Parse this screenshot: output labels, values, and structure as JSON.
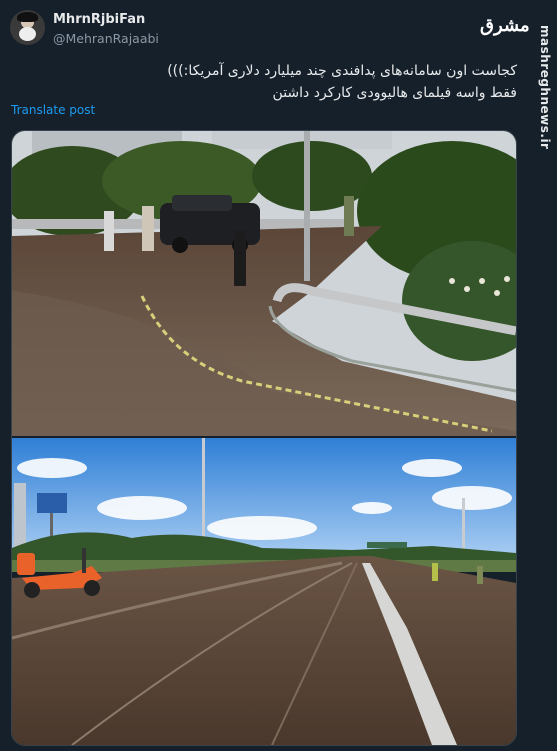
{
  "author": {
    "display_name": "MhrnRjbiFan",
    "handle": "@MehranRajaabi",
    "avatar_icon": "profile-avatar"
  },
  "logo": {
    "text": "مشرق",
    "icon": "mashregh-logo"
  },
  "watermark": "mashreghnews.ir",
  "tweet": {
    "line1": "کجاست اون سامانه‌های پدافندی چند میلیارد دلاری آمریکا:)))",
    "line2": "فقط واسه فیلمای هالیوودی کارکرد داشتن",
    "translate_label": "Translate post"
  },
  "media": {
    "photo1_icon": "highway-mud-photo",
    "photo2_icon": "road-mud-photo"
  },
  "colors": {
    "background": "#15202b",
    "link": "#1d9bf0",
    "secondary_text": "#8b98a5"
  }
}
